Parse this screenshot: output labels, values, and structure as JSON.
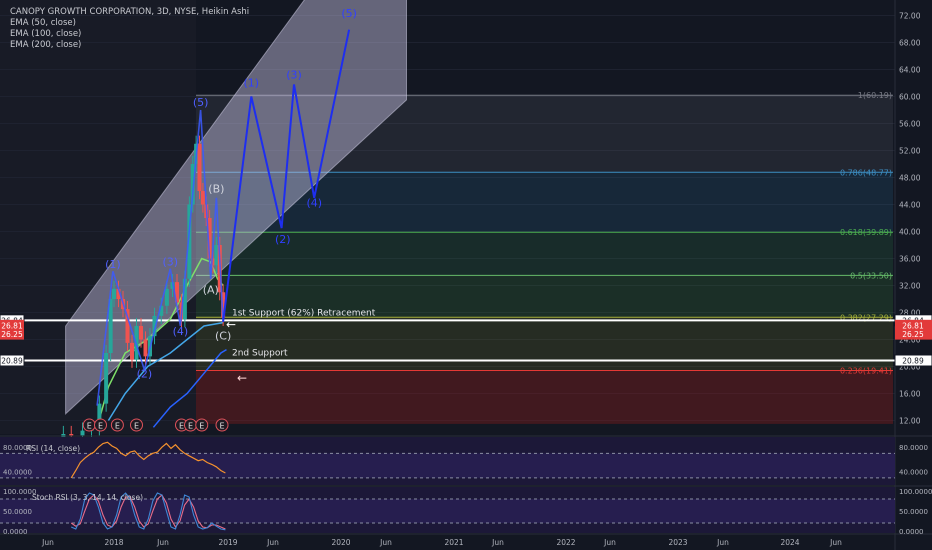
{
  "header": {
    "symbol_line": "CANOPY GROWTH CORPORATION, 3D, NYSE, Heikin Ashi",
    "indicators": [
      "EMA (50, close)",
      "EMA (100, close)",
      "EMA (200, close)"
    ]
  },
  "colors": {
    "background": "#131722",
    "price_text": "#b2b5be",
    "wave_line": "#1e2ef0",
    "ema50": "#7fe06a",
    "ema100": "#43a6e8",
    "ema200": "#2962ff",
    "rsi_line": "#f5922e",
    "stoch_k": "#3f87d6",
    "stoch_d": "#e86d8a"
  },
  "chart_data": {
    "type": "line",
    "price_axis": {
      "min": 10,
      "max": 74,
      "ticks": [
        "72.00",
        "68.00",
        "64.00",
        "60.00",
        "56.00",
        "52.00",
        "48.00",
        "44.00",
        "40.00",
        "36.00",
        "32.00",
        "28.00",
        "24.00",
        "20.00",
        "16.00",
        "12.00"
      ]
    },
    "time_axis": {
      "labels": [
        "Jun",
        "2018",
        "Jun",
        "2019",
        "Jun",
        "2020",
        "Jun",
        "2021",
        "Jun",
        "2022",
        "Jun",
        "2023",
        "Jun",
        "2024",
        "Jun"
      ]
    },
    "price_markers": [
      {
        "label": "26.84",
        "value": 26.84,
        "style": "white"
      },
      {
        "label": "26.81",
        "value": 26.1,
        "style": "red"
      },
      {
        "label": "26.25",
        "value": 24.8,
        "style": "red"
      },
      {
        "label": "20.89",
        "value": 20.89,
        "style": "white"
      }
    ],
    "fib_levels": [
      {
        "label": "1(60.19)",
        "value": 60.19,
        "color": "#787b86"
      },
      {
        "label": "0.786(48.77)",
        "value": 48.77,
        "color": "#3d8fc4"
      },
      {
        "label": "0.618(39.89)",
        "value": 39.89,
        "color": "#4caf50"
      },
      {
        "label": "0.5(33.50)",
        "value": 33.5,
        "color": "#66bb6a"
      },
      {
        "label": "0.382(27.29)",
        "value": 27.29,
        "color": "#a5b03a"
      },
      {
        "label": "0.236(19.41)",
        "value": 19.41,
        "color": "#e53935"
      }
    ],
    "support_lines": [
      {
        "label": "1st Support (62%) Retracement",
        "value": 26.84
      },
      {
        "label": "2nd Support",
        "value": 20.89
      }
    ],
    "wave_labels_past": [
      {
        "label": "(1)",
        "t": 2017.99,
        "v": 34.6
      },
      {
        "label": "(2)",
        "t": 2018.27,
        "v": 18.4
      },
      {
        "label": "(3)",
        "t": 2018.5,
        "v": 35.0
      },
      {
        "label": "(4)",
        "t": 2018.59,
        "v": 24.7
      },
      {
        "label": "(5)",
        "t": 2018.77,
        "v": 58.6
      },
      {
        "label": "(A)",
        "t": 2018.86,
        "v": 30.8
      },
      {
        "label": "(B)",
        "t": 2018.91,
        "v": 45.8
      },
      {
        "label": "(C)",
        "t": 2018.97,
        "v": 24.0
      }
    ],
    "wave_labels_projection": [
      {
        "label": "(1)",
        "t": 2019.22,
        "v": 61.5
      },
      {
        "label": "(2)",
        "t": 2019.5,
        "v": 38.3
      },
      {
        "label": "(3)",
        "t": 2019.6,
        "v": 62.7
      },
      {
        "label": "(4)",
        "t": 2019.78,
        "v": 43.7
      },
      {
        "label": "(5)",
        "t": 2020.09,
        "v": 71.8
      }
    ],
    "projection_path": [
      [
        2018.97,
        26.6
      ],
      [
        2019.22,
        60.0
      ],
      [
        2019.49,
        40.5
      ],
      [
        2019.6,
        61.8
      ],
      [
        2019.78,
        45.0
      ],
      [
        2020.09,
        69.9
      ]
    ],
    "past_wave_path": [
      [
        2017.85,
        14.2
      ],
      [
        2017.99,
        34.1
      ],
      [
        2018.27,
        19.5
      ],
      [
        2018.5,
        34.5
      ],
      [
        2018.59,
        26.0
      ],
      [
        2018.77,
        58.0
      ],
      [
        2018.86,
        33.0
      ],
      [
        2018.91,
        45.0
      ],
      [
        2018.97,
        26.6
      ]
    ],
    "price_series": [
      [
        2017.42,
        9.5
      ],
      [
        2017.55,
        10.0
      ],
      [
        2017.62,
        9.8
      ],
      [
        2017.72,
        10.5
      ],
      [
        2017.8,
        11.0
      ],
      [
        2017.87,
        14.5
      ],
      [
        2017.93,
        22.0
      ],
      [
        2017.97,
        30.0
      ],
      [
        2018.0,
        31.5
      ],
      [
        2018.04,
        30.0
      ],
      [
        2018.08,
        28.5
      ],
      [
        2018.12,
        23.5
      ],
      [
        2018.16,
        21.0
      ],
      [
        2018.2,
        26.0
      ],
      [
        2018.24,
        24.0
      ],
      [
        2018.28,
        21.5
      ],
      [
        2018.32,
        24.5
      ],
      [
        2018.36,
        27.5
      ],
      [
        2018.42,
        29.0
      ],
      [
        2018.47,
        31.5
      ],
      [
        2018.52,
        32.5
      ],
      [
        2018.56,
        29.5
      ],
      [
        2018.6,
        27.0
      ],
      [
        2018.63,
        33.0
      ],
      [
        2018.67,
        44.0
      ],
      [
        2018.7,
        50.0
      ],
      [
        2018.73,
        53.0
      ],
      [
        2018.76,
        46.0
      ],
      [
        2018.79,
        44.0
      ],
      [
        2018.82,
        42.0
      ],
      [
        2018.85,
        36.0
      ],
      [
        2018.88,
        35.0
      ],
      [
        2018.91,
        38.0
      ],
      [
        2018.94,
        31.0
      ],
      [
        2018.97,
        27.2
      ]
    ],
    "earnings_markers": [
      2017.78,
      2017.88,
      2018.03,
      2018.2,
      2018.6,
      2018.68,
      2018.78,
      2018.96
    ],
    "earnings_label": "E",
    "rsi": {
      "title": "RSI (14, close)",
      "ticks": [
        "80.0000",
        "40.0000"
      ],
      "values": [
        30,
        42,
        55,
        62,
        68,
        72,
        80,
        86,
        88,
        82,
        78,
        70,
        66,
        72,
        74,
        66,
        60,
        66,
        70,
        72,
        80,
        86,
        78,
        84,
        76,
        70,
        66,
        62,
        58,
        60,
        55,
        52,
        48,
        42,
        38
      ]
    },
    "stoch_rsi": {
      "title": "Stoch RSI (3, 3, 14, 14, close)",
      "ticks": [
        "100.0000",
        "50.0000",
        "0.0000"
      ],
      "k": [
        10,
        5,
        30,
        80,
        95,
        90,
        60,
        20,
        5,
        10,
        40,
        85,
        95,
        80,
        40,
        10,
        5,
        30,
        75,
        95,
        90,
        50,
        10,
        5,
        40,
        90,
        85,
        40,
        10,
        5,
        8,
        20,
        12,
        5,
        3
      ],
      "d": [
        20,
        12,
        18,
        50,
        80,
        90,
        75,
        40,
        15,
        10,
        25,
        60,
        85,
        85,
        60,
        25,
        10,
        18,
        50,
        80,
        90,
        70,
        30,
        10,
        25,
        65,
        80,
        60,
        25,
        10,
        8,
        15,
        15,
        10,
        5
      ]
    }
  }
}
